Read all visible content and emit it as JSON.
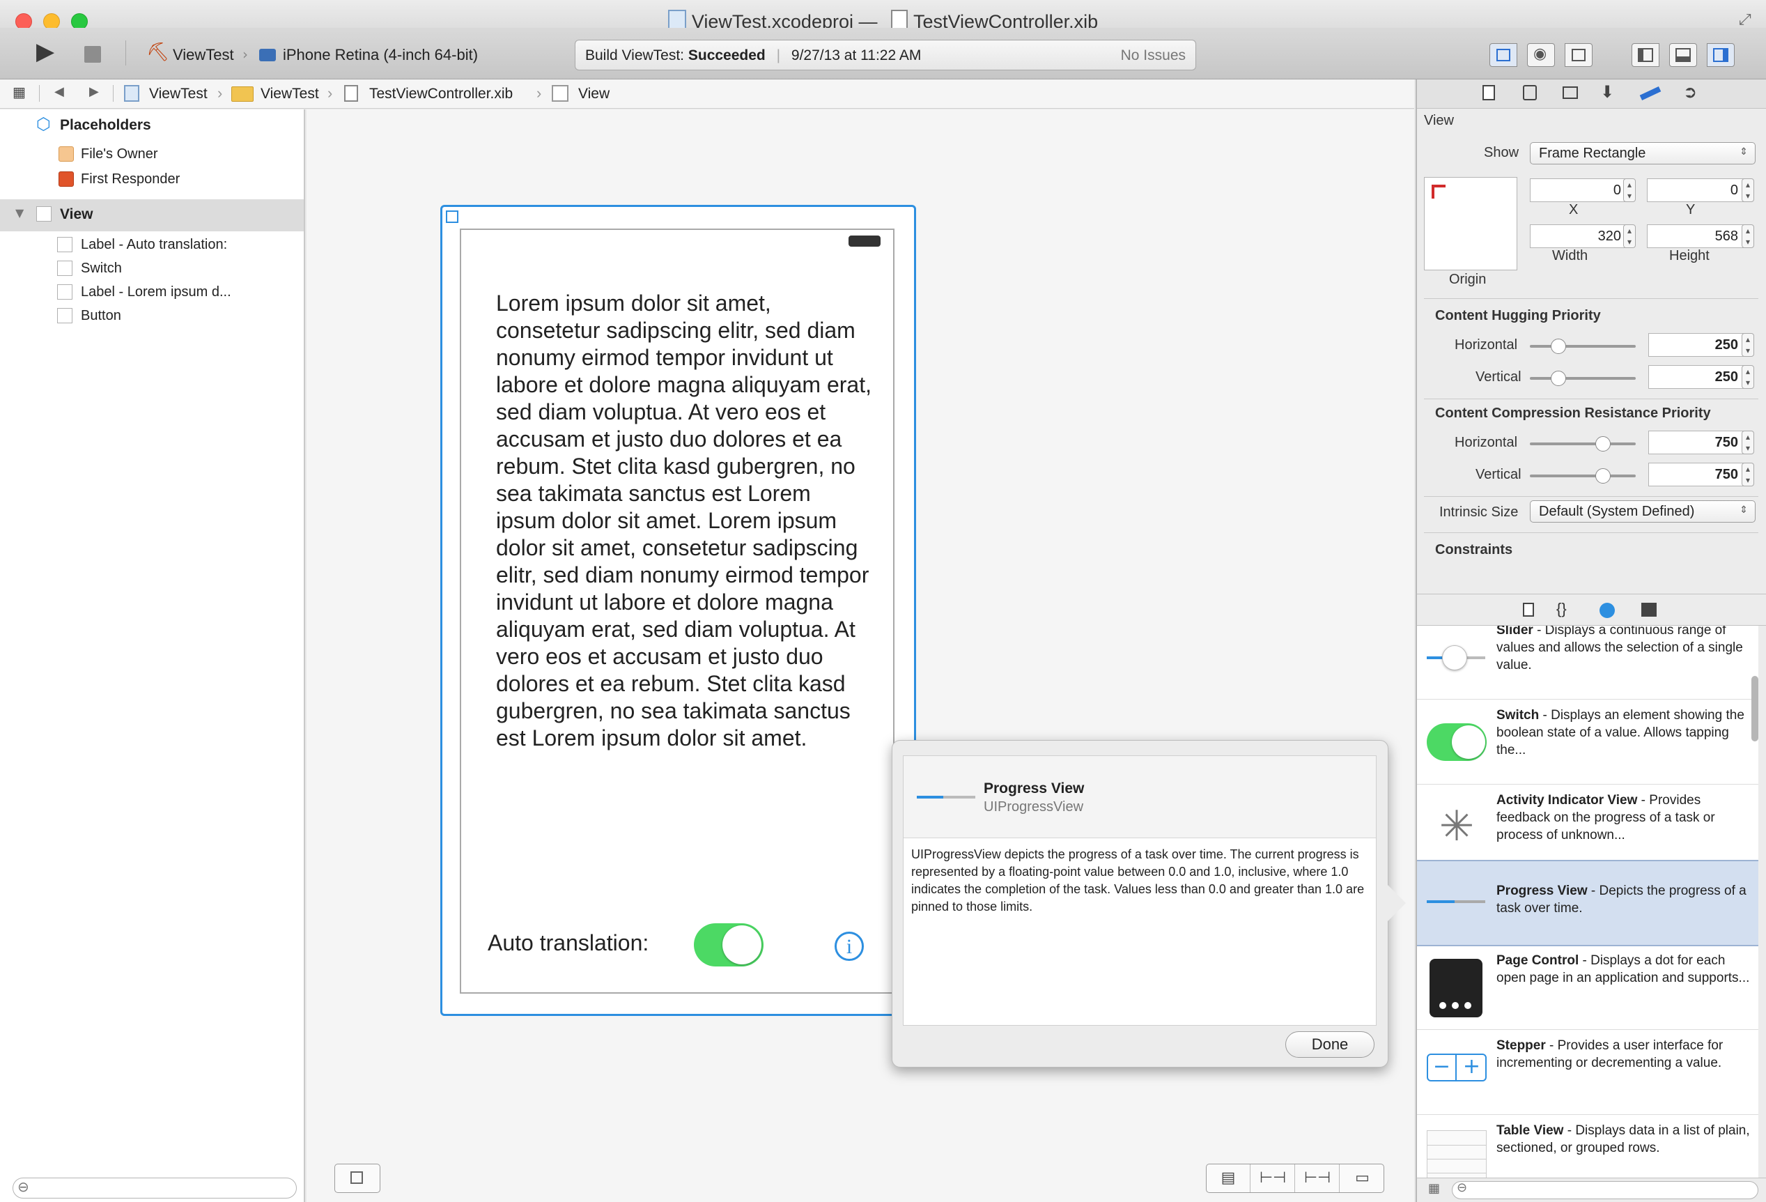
{
  "window": {
    "title_project": "ViewTest.xcodeproj",
    "title_dash": "—",
    "title_file": "TestViewController.xib"
  },
  "toolbar": {
    "scheme": "ViewTest",
    "destination": "iPhone Retina (4-inch 64-bit)",
    "build_prefix": "Build ViewTest: ",
    "build_status": "Succeeded",
    "build_sep": "|",
    "build_time": "9/27/13 at 11:22 AM",
    "issues": "No Issues"
  },
  "jumpbar": {
    "items": [
      "ViewTest",
      "ViewTest",
      "TestViewController.xib",
      "View"
    ]
  },
  "navigator": {
    "placeholders": "Placeholders",
    "files_owner": "File's Owner",
    "first_responder": "First Responder",
    "view": "View",
    "children": [
      "Label - Auto translation:",
      "Switch",
      "Label - Lorem ipsum d...",
      "Button"
    ]
  },
  "canvas": {
    "lorem": "Lorem ipsum dolor sit amet, consetetur sadipscing elitr, sed diam nonumy eirmod tempor invidunt ut labore et dolore magna aliquyam erat, sed diam voluptua. At vero eos et accusam et justo duo dolores et ea rebum. Stet clita kasd gubergren, no sea takimata sanctus est Lorem ipsum dolor sit amet. Lorem ipsum dolor sit amet, consetetur sadipscing elitr, sed diam nonumy eirmod tempor invidunt ut labore et dolore magna aliquyam erat, sed diam voluptua. At vero eos et accusam et justo duo dolores et ea rebum. Stet clita kasd gubergren, no sea takimata sanctus est Lorem ipsum dolor sit amet.",
    "auto_label": "Auto translation:",
    "switch_on": true,
    "info_glyph": "i"
  },
  "popover": {
    "title": "Progress View",
    "class_name": "UIProgressView",
    "description": "UIProgressView depicts the progress of a task over time. The current progress is represented by a floating-point value between 0.0 and 1.0, inclusive, where 1.0 indicates the completion of the task. Values less than 0.0 and greater than 1.0 are pinned to those limits.",
    "done": "Done"
  },
  "inspector": {
    "section": "View",
    "show_label": "Show",
    "show_value": "Frame Rectangle",
    "x": "0",
    "y": "0",
    "x_label": "X",
    "y_label": "Y",
    "width": "320",
    "height": "568",
    "width_label": "Width",
    "height_label": "Height",
    "origin_label": "Origin",
    "hugging_title": "Content Hugging Priority",
    "horizontal": "Horizontal",
    "vertical": "Vertical",
    "hug_h": "250",
    "hug_v": "250",
    "compression_title": "Content Compression Resistance Priority",
    "comp_h": "750",
    "comp_v": "750",
    "intrinsic_label": "Intrinsic Size",
    "intrinsic_value": "Default (System Defined)",
    "constraints": "Constraints"
  },
  "library": {
    "items": [
      {
        "name": "Slider",
        "desc": " - Displays a continuous range of values and allows the selection of a single value."
      },
      {
        "name": "Switch",
        "desc": " - Displays an element showing the boolean state of a value. Allows tapping the..."
      },
      {
        "name": "Activity Indicator View",
        "desc": " - Provides feedback on the progress of a task or process of unknown..."
      },
      {
        "name": "Progress View",
        "desc": " - Depicts the progress of a task over time."
      },
      {
        "name": "Page Control",
        "desc": " - Displays a dot for each open page in an application and supports..."
      },
      {
        "name": "Stepper",
        "desc": " - Provides a user interface for incrementing or decrementing a value."
      },
      {
        "name": "Table View",
        "desc": " - Displays data in a list of plain, sectioned, or grouped rows."
      }
    ]
  }
}
